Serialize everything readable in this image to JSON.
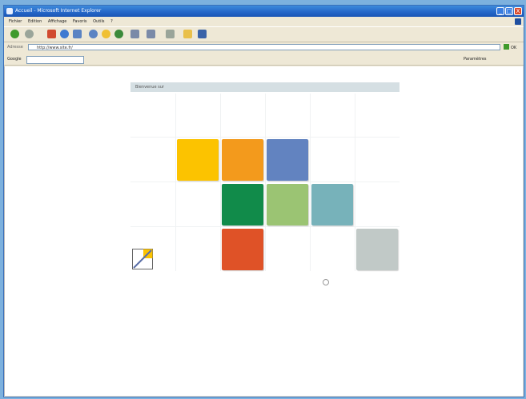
{
  "window": {
    "title": "Accueil - Microsoft Internet Explorer",
    "controls": {
      "minimize": "_",
      "maximize": "□",
      "close": "X"
    }
  },
  "menubar": {
    "items": [
      "Fichier",
      "Edition",
      "Affichage",
      "Favoris",
      "Outils",
      "?"
    ]
  },
  "toolbar": {
    "buttons": [
      {
        "name": "back-icon",
        "color": "#3e9a2b"
      },
      {
        "name": "forward-icon",
        "color": "#9aa59a"
      },
      {
        "name": "stop-icon",
        "color": "#d14a2f"
      },
      {
        "name": "refresh-icon",
        "color": "#3f7ad1"
      },
      {
        "name": "home-icon",
        "color": "#5a83c3"
      },
      {
        "name": "search-icon",
        "color": "#5a83c3"
      },
      {
        "name": "favorites-icon",
        "color": "#f0c033"
      },
      {
        "name": "history-icon",
        "color": "#3b8a3b"
      },
      {
        "name": "mail-icon",
        "color": "#7a8aa8"
      },
      {
        "name": "print-icon",
        "color": "#7a8aa8"
      },
      {
        "name": "folder-icon",
        "color": "#e9c04a"
      },
      {
        "name": "messenger-icon",
        "color": "#3a63a8"
      }
    ]
  },
  "address": {
    "label": "Adresse",
    "value": "http://www.site.fr/",
    "go_label": "OK"
  },
  "googlebar": {
    "label": "Google",
    "search_value": "",
    "right_label": "Paramètres"
  },
  "page": {
    "header": {
      "prefix": "Bienvenue sur ",
      "highlight": "",
      "suffix": ""
    },
    "tiles": [
      {
        "name": "tile-yellow",
        "color": "#fcc300"
      },
      {
        "name": "tile-orange",
        "color": "#f39a1c"
      },
      {
        "name": "tile-blue",
        "color": "#6283c0"
      },
      {
        "name": "tile-dark-green",
        "color": "#118b4a"
      },
      {
        "name": "tile-light-green",
        "color": "#9bc473"
      },
      {
        "name": "tile-teal",
        "color": "#77b2ba"
      },
      {
        "name": "tile-red-orange",
        "color": "#df5227"
      },
      {
        "name": "tile-gray",
        "color": "#c1c9c7"
      }
    ],
    "labels": [],
    "footer_link": ""
  }
}
